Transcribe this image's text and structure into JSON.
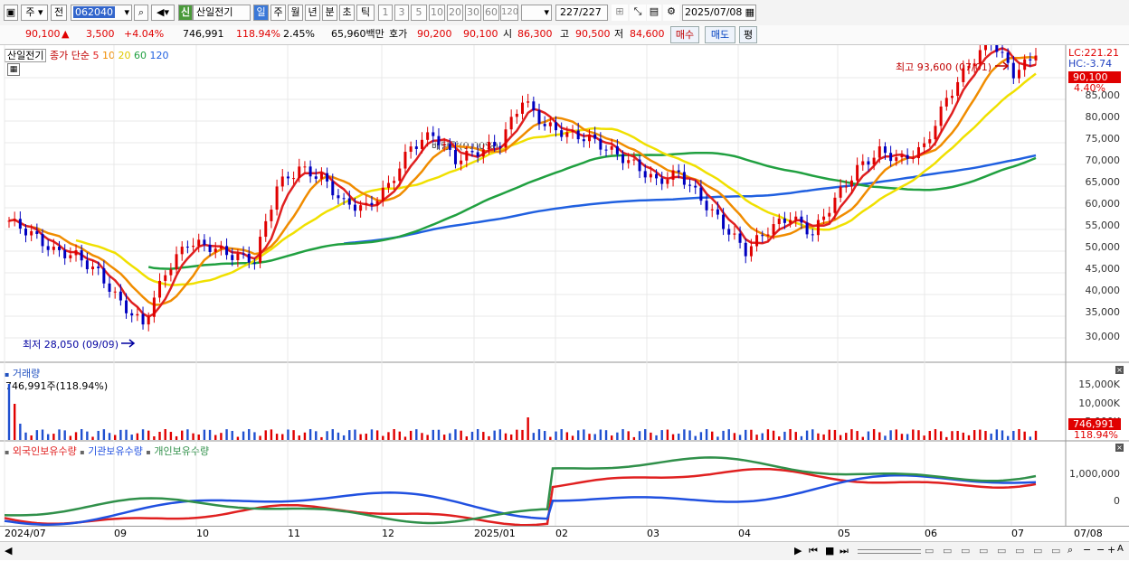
{
  "toolbar": {
    "market": "주",
    "prev_label": "전",
    "code": "062040",
    "credit_badge": "신",
    "stock_name": "산일전기",
    "periods": [
      "일",
      "주",
      "월",
      "년",
      "분",
      "초",
      "틱"
    ],
    "intervals": [
      "1",
      "3",
      "5",
      "10",
      "20",
      "30",
      "60",
      "120"
    ],
    "count": "227",
    "count_total": "/227",
    "date": "2025/07/08"
  },
  "quote": {
    "price": "90,100",
    "change": "3,500",
    "change_pct": "+4.04%",
    "volume": "746,991",
    "volume_ratio": "118.94%",
    "turnover": "2.45%",
    "amount": "65,960백만",
    "ask_label": "호가",
    "ask": "90,200",
    "bid": "90,100",
    "open_label": "시",
    "open": "86,300",
    "high_label": "고",
    "high": "90,500",
    "low_label": "저",
    "low": "84,600",
    "buy_label": "매수",
    "sell_label": "매도",
    "avg_label": "평"
  },
  "price_pane": {
    "stock_label": "산일전기",
    "ma_label": "종가 단순",
    "ma_periods": [
      "5",
      "10",
      "20",
      "60",
      "120"
    ],
    "ma_colors": [
      "#e02020",
      "#f08c00",
      "#f0e000",
      "#20a040",
      "#2060e0"
    ],
    "lc": "LC:221.21",
    "hc": "HC:-3.74",
    "price_tag": "90,100",
    "pct_tag": "4.40%",
    "high_note": "최고 93,600 (07/01)",
    "low_note": "최저 28,050 (09/09)",
    "dividend_note": "배당락(0.00%)",
    "y_ticks": [
      "85,000",
      "80,000",
      "75,000",
      "70,000",
      "65,000",
      "60,000",
      "55,000",
      "50,000",
      "45,000",
      "40,000",
      "35,000",
      "30,000"
    ]
  },
  "volume_pane": {
    "title": "거래량",
    "info": "746,991주(118.94%)",
    "y_ticks": [
      "15,000K",
      "10,000K",
      "5,000K"
    ],
    "last_tag": "746,991",
    "last_pct": "118.94%"
  },
  "holding_pane": {
    "legends": [
      "외국인보유수량",
      "기관보유수량",
      "개인보유수량"
    ],
    "legend_colors": [
      "#e02020",
      "#2050e0",
      "#30904a"
    ],
    "y_ticks": [
      "1,000,000",
      "0"
    ]
  },
  "x_axis": [
    "2024/07",
    "09",
    "10",
    "11",
    "12",
    "2025/01",
    "02",
    "03",
    "04",
    "05",
    "06",
    "07",
    "07/08"
  ],
  "chart_data": {
    "type": "candlestick",
    "series": [
      {
        "name": "종가",
        "values": [
          52000,
          49000,
          45000,
          44000,
          40000,
          33000,
          28050,
          40000,
          47000,
          46000,
          44000,
          43000,
          60000,
          64000,
          62000,
          56000,
          55000,
          60000,
          69000,
          72000,
          66000,
          68000,
          70000,
          80000,
          74000,
          72000,
          71000,
          68000,
          65000,
          61000,
          63000,
          57000,
          51000,
          45000,
          50000,
          53000,
          49000,
          57000,
          64000,
          68000,
          66000,
          69000,
          80000,
          88000,
          93600,
          86000,
          90100
        ]
      }
    ],
    "ylim": [
      25000,
      95000
    ]
  }
}
